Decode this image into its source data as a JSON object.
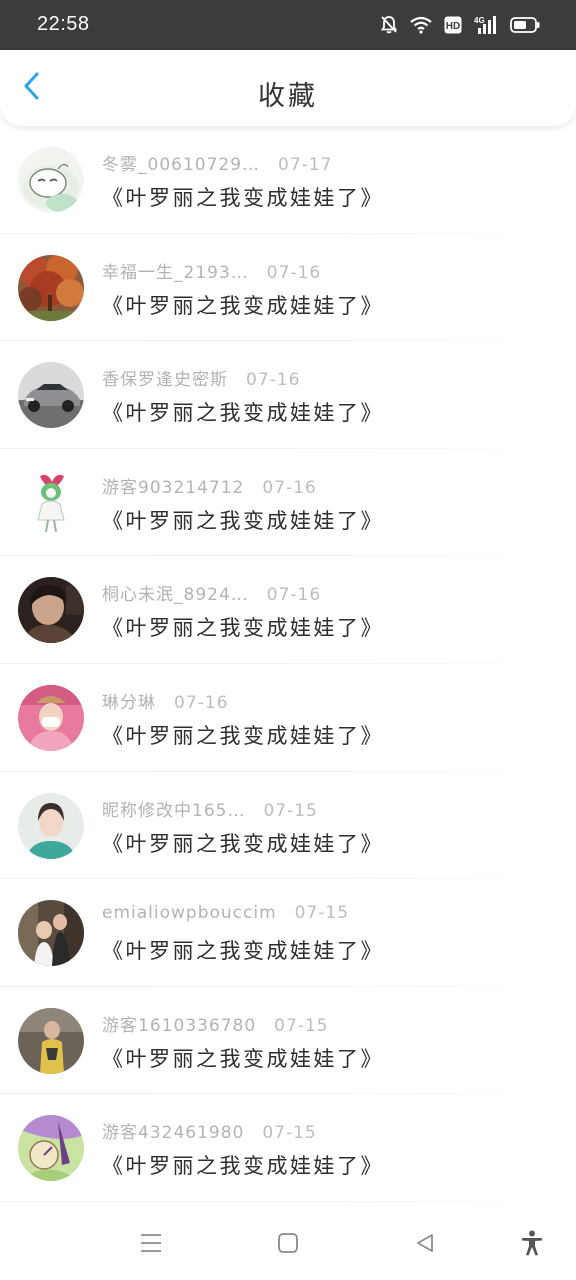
{
  "status_bar": {
    "time": "22:58",
    "icons": [
      "bell-off-icon",
      "wifi-icon",
      "hd-icon",
      "4g-signal-icon",
      "battery-icon"
    ],
    "hd_label": "HD",
    "network_label": "4G"
  },
  "header": {
    "title": "收藏",
    "back_icon": "chevron-left-icon",
    "accent_color": "#2aa3e8"
  },
  "favorites": [
    {
      "username": "冬雾_00610729…",
      "date": "07-17",
      "title": "《叶罗丽之我变成娃娃了》"
    },
    {
      "username": "幸福一生_2193…",
      "date": "07-16",
      "title": "《叶罗丽之我变成娃娃了》"
    },
    {
      "username": "香保罗逢史密斯",
      "date": "07-16",
      "title": "《叶罗丽之我变成娃娃了》"
    },
    {
      "username": "游客903214712",
      "date": "07-16",
      "title": "《叶罗丽之我变成娃娃了》"
    },
    {
      "username": "桐心未泯_8924…",
      "date": "07-16",
      "title": "《叶罗丽之我变成娃娃了》"
    },
    {
      "username": "琳分琳",
      "date": "07-16",
      "title": "《叶罗丽之我变成娃娃了》"
    },
    {
      "username": "昵称修改中165…",
      "date": "07-15",
      "title": "《叶罗丽之我变成娃娃了》"
    },
    {
      "username": "emialiowpbouccim",
      "date": "07-15",
      "title": "《叶罗丽之我变成娃娃了》"
    },
    {
      "username": "游客1610336780",
      "date": "07-15",
      "title": "《叶罗丽之我变成娃娃了》"
    },
    {
      "username": "游客432461980",
      "date": "07-15",
      "title": "《叶罗丽之我变成娃娃了》"
    }
  ],
  "navbar": {
    "icons": [
      "menu-icon",
      "home-square-icon",
      "back-triangle-icon",
      "accessibility-icon"
    ]
  }
}
